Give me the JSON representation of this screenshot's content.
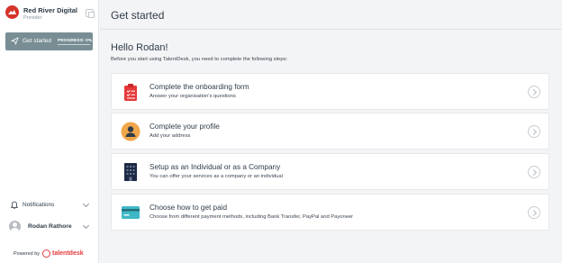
{
  "sidebar": {
    "org_name": "Red River Digital",
    "org_role": "Provider",
    "get_started": {
      "label": "Get started",
      "progress_label": "PROGRESS: 0%",
      "progress": 0
    },
    "notifications_label": "Notifications",
    "user_name": "Rodan Rathore",
    "powered_by": "Powered by",
    "brand": "talentdesk"
  },
  "header": {
    "title": "Get started"
  },
  "main": {
    "greeting": "Hello Rodan!",
    "intro": "Before you start using TalentDesk, you need to complete the following steps:",
    "steps": [
      {
        "title": "Complete the onboarding form",
        "description": "Answer your organisation's questions",
        "icon": "clipboard-icon",
        "icon_color": "#e5393a"
      },
      {
        "title": "Complete your profile",
        "description": "Add your address",
        "icon": "user-circle-icon",
        "icon_color": "#f0a64a"
      },
      {
        "title": "Setup as an Individual or as a Company",
        "description": "You can offer your services as a company or an individual",
        "icon": "building-icon",
        "icon_color": "#1f2a44"
      },
      {
        "title": "Choose how to get paid",
        "description": "Choose from different payment methods, including Bank Transfer, PayPal and Payoneer",
        "icon": "card-icon",
        "icon_color": "#3fb8c6"
      }
    ]
  },
  "colors": {
    "sidebar_active": "#788e94",
    "brand_red": "#e5393a",
    "background": "#f3f4f6"
  }
}
